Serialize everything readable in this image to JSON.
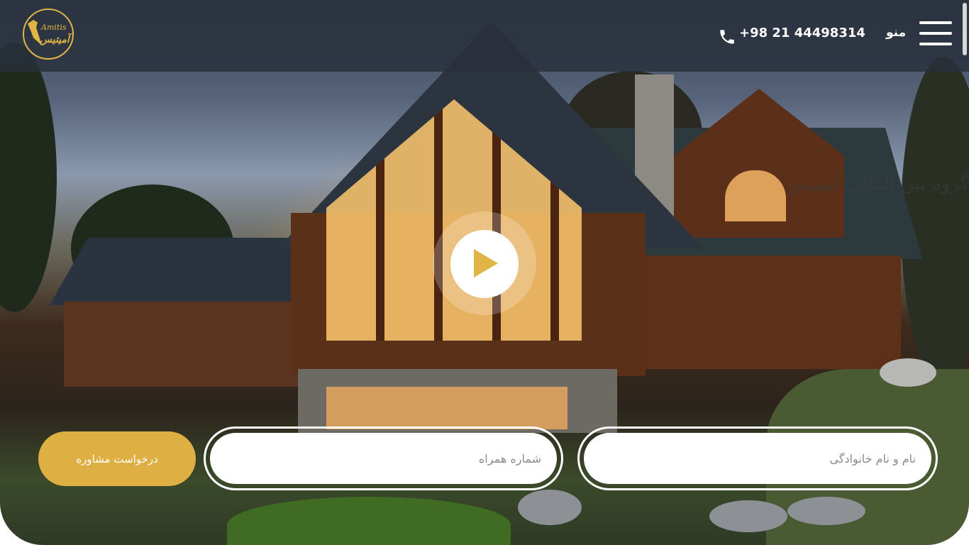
{
  "brand": {
    "logo_latin": "Amitis",
    "logo_persian": "آمیتیس",
    "accent_color": "#deb043"
  },
  "header": {
    "menu_label": "منو",
    "phone": "+98 21 44498314",
    "phone_icon": "phone-icon",
    "menu_icon": "hamburger-icon"
  },
  "hero": {
    "headline": "گروه بین المللی آمیتیس",
    "play_icon": "play-icon"
  },
  "form": {
    "name_placeholder": "نام و نام خانوادگی",
    "mobile_placeholder": "شماره همراه",
    "submit_label": "درخواست مشاوره"
  }
}
